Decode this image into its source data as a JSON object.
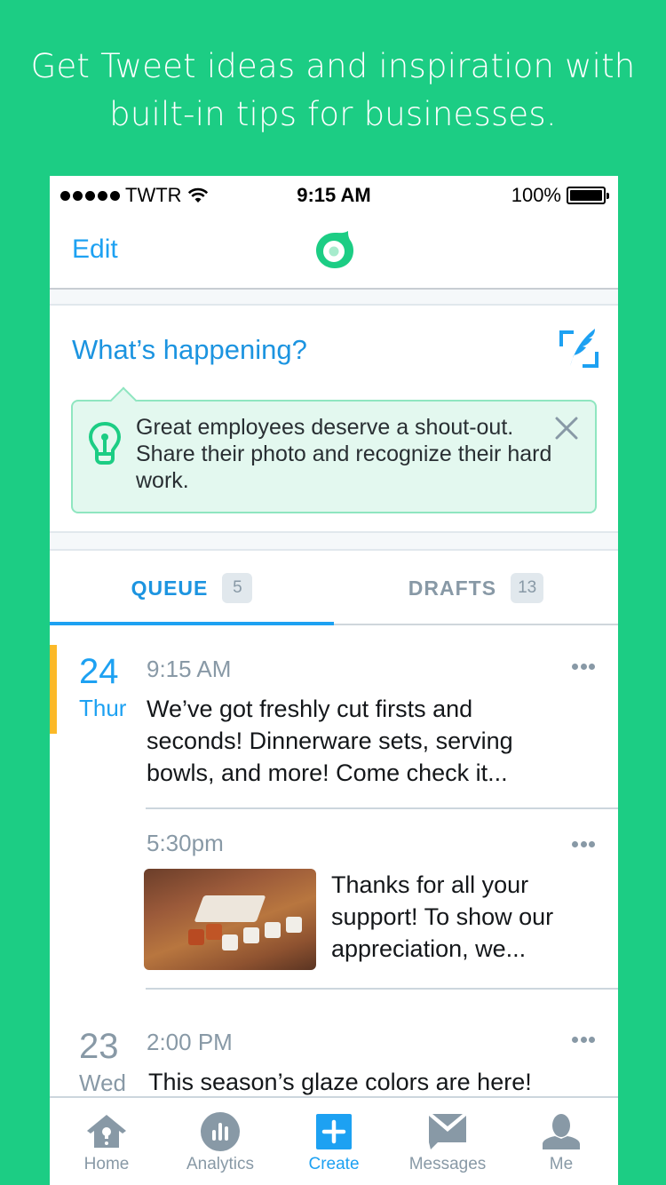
{
  "headline": {
    "line1": "Get Tweet ideas and inspiration with",
    "line2": "built-in tips for businesses."
  },
  "status_bar": {
    "carrier": "TWTR",
    "signal_bars": 5,
    "time": "9:15 AM",
    "battery": "100%",
    "battery_level": 1.0
  },
  "nav": {
    "edit_label": "Edit",
    "logo_icon": "twitter-dashboard-logo"
  },
  "compose": {
    "placeholder": "What’s happening?",
    "compose_icon": "quill-compose-icon"
  },
  "tip": {
    "icon": "lightbulb-icon",
    "text": "Great employees deserve a shout-out. Share their photo and recognize their hard work.",
    "close_icon": "close-icon"
  },
  "tabs": [
    {
      "label": "QUEUE",
      "count": "5",
      "active": true
    },
    {
      "label": "DRAFTS",
      "count": "13",
      "active": false
    }
  ],
  "queue": [
    {
      "date": "24",
      "day": "Thur",
      "posts": [
        {
          "time": "9:15 AM",
          "text": "We’ve got freshly cut firsts and seconds! Dinnerware sets, serving bowls, and more! Come check it...",
          "has_image": false
        },
        {
          "time": "5:30pm",
          "text": "Thanks for all your support! To show our appreciation, we...",
          "has_image": true,
          "image_desc": "Enamel mugs on a wooden table"
        }
      ]
    },
    {
      "date": "23",
      "day": "Wed",
      "posts": [
        {
          "time": "2:00 PM",
          "text": "This season’s glaze colors are here!",
          "has_image": false
        }
      ]
    }
  ],
  "tabbar": [
    {
      "label": "Home",
      "icon": "birdhouse-home-icon",
      "active": false
    },
    {
      "label": "Analytics",
      "icon": "analytics-icon",
      "active": false
    },
    {
      "label": "Create",
      "icon": "plus-create-icon",
      "active": true
    },
    {
      "label": "Messages",
      "icon": "messages-icon",
      "active": false
    },
    {
      "label": "Me",
      "icon": "person-icon",
      "active": false
    }
  ],
  "colors": {
    "background": "#1ccd84",
    "accent_blue": "#1da1f2",
    "tip_bg": "#e3f8ef",
    "tip_border": "#8fe6c0",
    "today_marker": "#fbb928",
    "muted": "#8899a6"
  }
}
